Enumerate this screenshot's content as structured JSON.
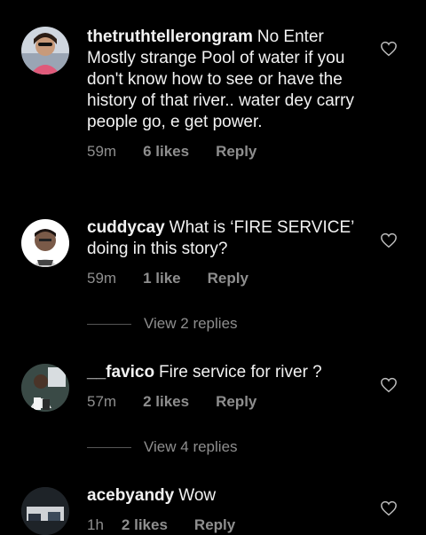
{
  "comments": [
    {
      "username": "thetruthtellerongram",
      "text": "No Enter Mostly strange Pool of water if you don't know how to see or have the history of that river.. water dey carry people go, e get power.",
      "time": "59m",
      "likes": "6 likes",
      "reply": "Reply"
    },
    {
      "username": "cuddycay",
      "text": "What is ‘FIRE SERVICE’ doing in this story?",
      "time": "59m",
      "likes": "1 like",
      "reply": "Reply"
    },
    {
      "username": "__favico",
      "text": "Fire service for river ?",
      "time": "57m",
      "likes": "2 likes",
      "reply": "Reply"
    },
    {
      "username": "acebyandy",
      "text": "Wow",
      "time": "1h",
      "likes": "2 likes",
      "reply": "Reply"
    }
  ],
  "view_replies": [
    "View 2 replies",
    "View 4 replies"
  ],
  "icons": {
    "like": "heart-outline-icon"
  },
  "colors": {
    "background": "#000000",
    "text": "#f2f2f2",
    "meta": "#8e8e8e"
  }
}
